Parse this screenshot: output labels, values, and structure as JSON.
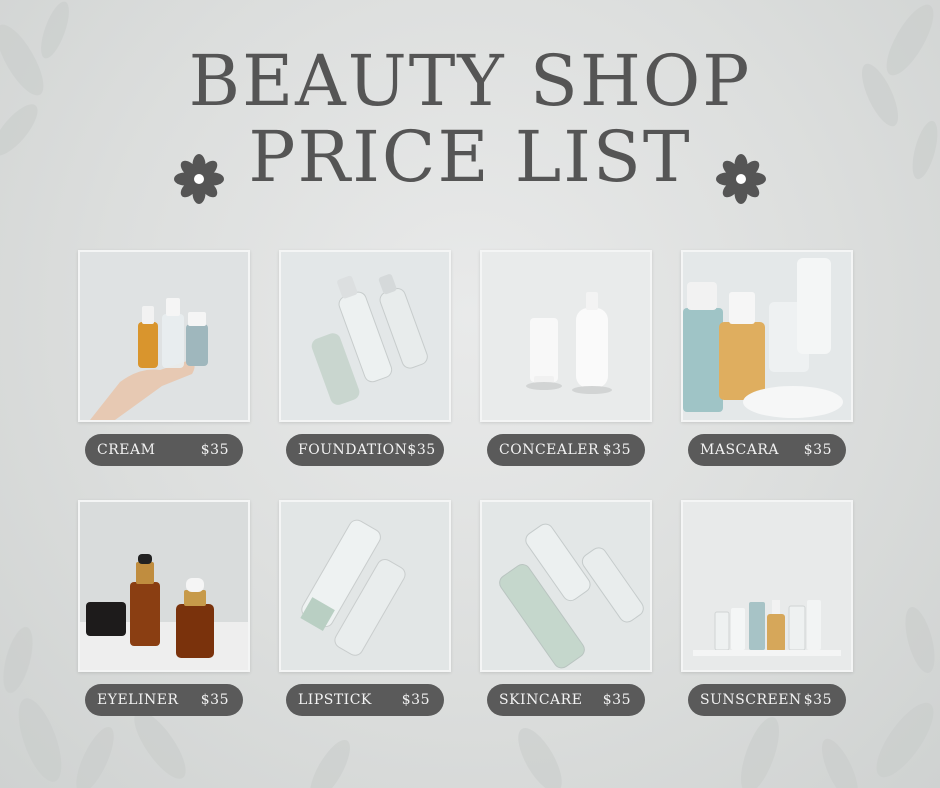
{
  "title_line1": "BEAUTY SHOP",
  "title_line2": "PRICE LIST",
  "items": [
    {
      "name": "CREAM",
      "price": "$35"
    },
    {
      "name": "FOUNDATION",
      "price": "$35"
    },
    {
      "name": "CONCEALER",
      "price": "$35"
    },
    {
      "name": "MASCARA",
      "price": "$35"
    },
    {
      "name": "EYELINER",
      "price": "$35"
    },
    {
      "name": "LIPSTICK",
      "price": "$35"
    },
    {
      "name": "SKINCARE",
      "price": "$35"
    },
    {
      "name": "SUNSCREEN",
      "price": "$35"
    }
  ],
  "colors": {
    "background": "#dcdedd",
    "title": "#555555",
    "pill": "#5a5a5a",
    "pill_text": "#f2f2f2"
  }
}
